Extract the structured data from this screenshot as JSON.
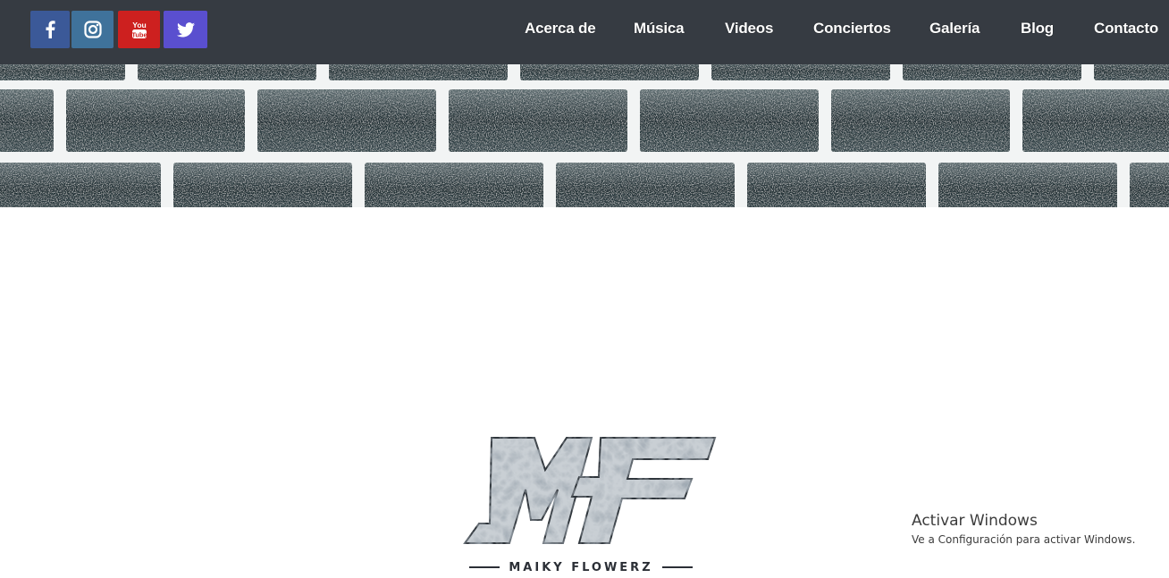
{
  "social": [
    {
      "name": "facebook",
      "icon": "facebook-icon",
      "color": "#3b5998"
    },
    {
      "name": "instagram",
      "icon": "instagram-icon",
      "color": "#3f729b"
    },
    {
      "name": "youtube",
      "icon": "youtube-icon",
      "label_top": "You",
      "label_bottom": "Tube",
      "color": "#cd201f"
    },
    {
      "name": "twitter",
      "icon": "twitter-icon",
      "color": "#5a4fcf"
    }
  ],
  "nav": [
    {
      "label": "Acerca de"
    },
    {
      "label": "Música"
    },
    {
      "label": "Videos"
    },
    {
      "label": "Conciertos"
    },
    {
      "label": "Galería"
    },
    {
      "label": "Blog"
    },
    {
      "label": "Contacto"
    }
  ],
  "banner": {
    "kind": "brick-wall-image"
  },
  "logo": {
    "monogram": "MF",
    "name": "MAIKY FLOWERZ"
  },
  "watermark": {
    "title": "Activar Windows",
    "subtitle": "Ve a Configuración para activar Windows."
  },
  "colors": {
    "topbar": "#363b42",
    "nav_text": "#ffffff"
  }
}
